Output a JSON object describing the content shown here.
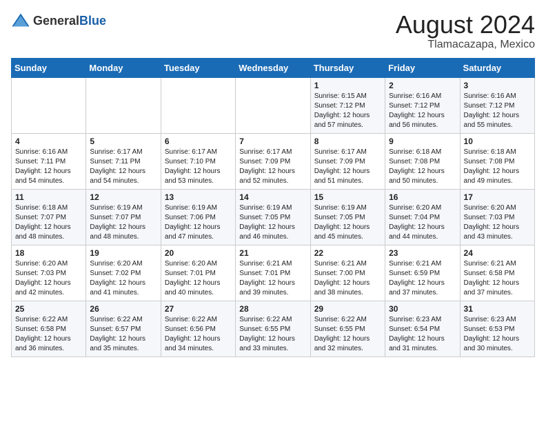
{
  "header": {
    "logo_general": "General",
    "logo_blue": "Blue",
    "title": "August 2024",
    "subtitle": "Tlamacazapa, Mexico"
  },
  "weekdays": [
    "Sunday",
    "Monday",
    "Tuesday",
    "Wednesday",
    "Thursday",
    "Friday",
    "Saturday"
  ],
  "weeks": [
    [
      {
        "day": "",
        "info": ""
      },
      {
        "day": "",
        "info": ""
      },
      {
        "day": "",
        "info": ""
      },
      {
        "day": "",
        "info": ""
      },
      {
        "day": "1",
        "info": "Sunrise: 6:15 AM\nSunset: 7:12 PM\nDaylight: 12 hours and 57 minutes."
      },
      {
        "day": "2",
        "info": "Sunrise: 6:16 AM\nSunset: 7:12 PM\nDaylight: 12 hours and 56 minutes."
      },
      {
        "day": "3",
        "info": "Sunrise: 6:16 AM\nSunset: 7:12 PM\nDaylight: 12 hours and 55 minutes."
      }
    ],
    [
      {
        "day": "4",
        "info": "Sunrise: 6:16 AM\nSunset: 7:11 PM\nDaylight: 12 hours and 54 minutes."
      },
      {
        "day": "5",
        "info": "Sunrise: 6:17 AM\nSunset: 7:11 PM\nDaylight: 12 hours and 54 minutes."
      },
      {
        "day": "6",
        "info": "Sunrise: 6:17 AM\nSunset: 7:10 PM\nDaylight: 12 hours and 53 minutes."
      },
      {
        "day": "7",
        "info": "Sunrise: 6:17 AM\nSunset: 7:09 PM\nDaylight: 12 hours and 52 minutes."
      },
      {
        "day": "8",
        "info": "Sunrise: 6:17 AM\nSunset: 7:09 PM\nDaylight: 12 hours and 51 minutes."
      },
      {
        "day": "9",
        "info": "Sunrise: 6:18 AM\nSunset: 7:08 PM\nDaylight: 12 hours and 50 minutes."
      },
      {
        "day": "10",
        "info": "Sunrise: 6:18 AM\nSunset: 7:08 PM\nDaylight: 12 hours and 49 minutes."
      }
    ],
    [
      {
        "day": "11",
        "info": "Sunrise: 6:18 AM\nSunset: 7:07 PM\nDaylight: 12 hours and 48 minutes."
      },
      {
        "day": "12",
        "info": "Sunrise: 6:19 AM\nSunset: 7:07 PM\nDaylight: 12 hours and 48 minutes."
      },
      {
        "day": "13",
        "info": "Sunrise: 6:19 AM\nSunset: 7:06 PM\nDaylight: 12 hours and 47 minutes."
      },
      {
        "day": "14",
        "info": "Sunrise: 6:19 AM\nSunset: 7:05 PM\nDaylight: 12 hours and 46 minutes."
      },
      {
        "day": "15",
        "info": "Sunrise: 6:19 AM\nSunset: 7:05 PM\nDaylight: 12 hours and 45 minutes."
      },
      {
        "day": "16",
        "info": "Sunrise: 6:20 AM\nSunset: 7:04 PM\nDaylight: 12 hours and 44 minutes."
      },
      {
        "day": "17",
        "info": "Sunrise: 6:20 AM\nSunset: 7:03 PM\nDaylight: 12 hours and 43 minutes."
      }
    ],
    [
      {
        "day": "18",
        "info": "Sunrise: 6:20 AM\nSunset: 7:03 PM\nDaylight: 12 hours and 42 minutes."
      },
      {
        "day": "19",
        "info": "Sunrise: 6:20 AM\nSunset: 7:02 PM\nDaylight: 12 hours and 41 minutes."
      },
      {
        "day": "20",
        "info": "Sunrise: 6:20 AM\nSunset: 7:01 PM\nDaylight: 12 hours and 40 minutes."
      },
      {
        "day": "21",
        "info": "Sunrise: 6:21 AM\nSunset: 7:01 PM\nDaylight: 12 hours and 39 minutes."
      },
      {
        "day": "22",
        "info": "Sunrise: 6:21 AM\nSunset: 7:00 PM\nDaylight: 12 hours and 38 minutes."
      },
      {
        "day": "23",
        "info": "Sunrise: 6:21 AM\nSunset: 6:59 PM\nDaylight: 12 hours and 37 minutes."
      },
      {
        "day": "24",
        "info": "Sunrise: 6:21 AM\nSunset: 6:58 PM\nDaylight: 12 hours and 37 minutes."
      }
    ],
    [
      {
        "day": "25",
        "info": "Sunrise: 6:22 AM\nSunset: 6:58 PM\nDaylight: 12 hours and 36 minutes."
      },
      {
        "day": "26",
        "info": "Sunrise: 6:22 AM\nSunset: 6:57 PM\nDaylight: 12 hours and 35 minutes."
      },
      {
        "day": "27",
        "info": "Sunrise: 6:22 AM\nSunset: 6:56 PM\nDaylight: 12 hours and 34 minutes."
      },
      {
        "day": "28",
        "info": "Sunrise: 6:22 AM\nSunset: 6:55 PM\nDaylight: 12 hours and 33 minutes."
      },
      {
        "day": "29",
        "info": "Sunrise: 6:22 AM\nSunset: 6:55 PM\nDaylight: 12 hours and 32 minutes."
      },
      {
        "day": "30",
        "info": "Sunrise: 6:23 AM\nSunset: 6:54 PM\nDaylight: 12 hours and 31 minutes."
      },
      {
        "day": "31",
        "info": "Sunrise: 6:23 AM\nSunset: 6:53 PM\nDaylight: 12 hours and 30 minutes."
      }
    ]
  ]
}
